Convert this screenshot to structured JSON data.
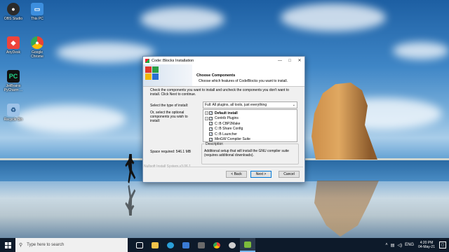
{
  "desktop": {
    "icons": [
      {
        "label": "OBS Studio",
        "icon": "obs-icon",
        "color": "#2b2b2b"
      },
      {
        "label": "This PC",
        "icon": "this-pc-icon",
        "color": "#3c8ede"
      },
      {
        "label": "AnyDesk",
        "icon": "anydesk-icon",
        "color": "#ef443b"
      },
      {
        "label": "Google Chrome",
        "icon": "chrome-icon",
        "color": "#34a853"
      },
      {
        "label": "JetBrains PyCharm ...",
        "icon": "pycharm-icon",
        "color": "#111111"
      },
      {
        "label": "Recycle Bin",
        "icon": "recycle-bin-icon",
        "color": "#9ec3e8"
      }
    ]
  },
  "window": {
    "title": "Code::Blocks Installation",
    "header_title": "Choose Components",
    "header_subtitle": "Choose which features of CodeBlocks you want to install.",
    "intro": "Check the components you want to install and uncheck the components you don't want to install. Click Next to continue.",
    "type_label": "Select the type of install:",
    "install_type": "Full: All plugins, all tools, just everything",
    "optional_label": "Or, select the optional components you wish to install:",
    "components": [
      {
        "label": "Default install",
        "bold": true,
        "expander": "+",
        "checked": true
      },
      {
        "label": "Contrib Plugins",
        "bold": false,
        "expander": "+",
        "checked": true
      },
      {
        "label": "C::B CBP2Make",
        "bold": false,
        "expander": "",
        "checked": true
      },
      {
        "label": "C::B Share Config",
        "bold": false,
        "expander": "",
        "checked": true
      },
      {
        "label": "C::B Launcher",
        "bold": false,
        "expander": "",
        "checked": true
      },
      {
        "label": "MinGW Compiler Suite",
        "bold": false,
        "expander": "",
        "checked": true
      }
    ],
    "space_required": "Space required: 546.1 MB",
    "description_title": "Description",
    "description_text": "Additional setup that will install the GNU compiler suite (requires additional downloads).",
    "nsis": "Nullsoft Install System v3.06.1",
    "buttons": {
      "back": "< Back",
      "next": "Next >",
      "cancel": "Cancel"
    }
  },
  "taskbar": {
    "search_placeholder": "Type here to search",
    "pinned": [
      {
        "icon": "task-view-icon",
        "color": "#ffffff"
      },
      {
        "icon": "file-explorer-icon",
        "color": "#f3c34a"
      },
      {
        "icon": "edge-icon",
        "color": "#2a9fd8"
      },
      {
        "icon": "mail-icon",
        "color": "#3a7bd5"
      },
      {
        "icon": "store-icon",
        "color": "#6b6b6b"
      },
      {
        "icon": "chrome-icon",
        "color": "#e84234"
      },
      {
        "icon": "obs-icon",
        "color": "#cfcfcf"
      },
      {
        "icon": "codeblocks-icon",
        "color": "#7dbb3c"
      }
    ],
    "time": "4:20 PM",
    "date": "04-May-21",
    "language": "ENG"
  }
}
